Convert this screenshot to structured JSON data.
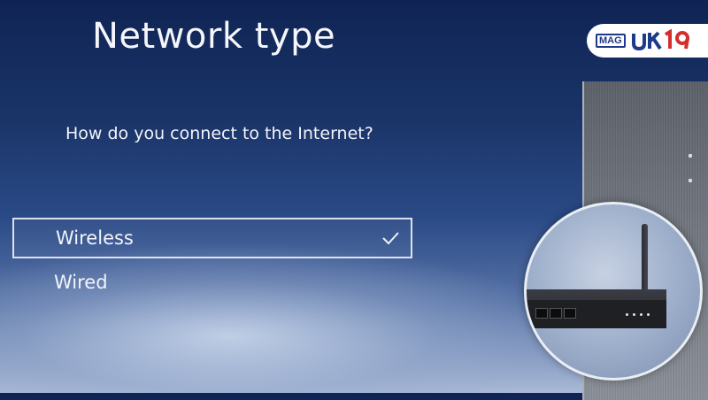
{
  "screen": {
    "title": "Network type",
    "question": "How do you connect to the Internet?"
  },
  "options": [
    {
      "label": "Wireless",
      "selected": true
    },
    {
      "label": "Wired",
      "selected": false
    }
  ],
  "logo": {
    "mag_text": "MAG",
    "brand_text": "UK19"
  },
  "colors": {
    "accent_logo": "#1e3a8a",
    "logo_red": "#d32f2f"
  },
  "icons": {
    "check": "check-icon"
  }
}
